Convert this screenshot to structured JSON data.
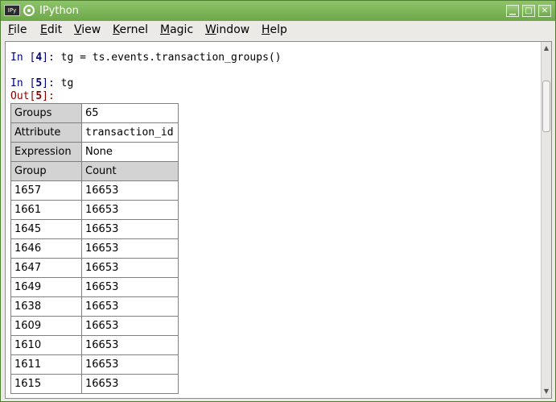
{
  "window": {
    "title": "IPython",
    "app_icon_text": "IPy",
    "minimize_glyph": "▁",
    "maximize_glyph": "□",
    "close_glyph": "✕"
  },
  "menu": [
    {
      "label": "File",
      "accel": "F",
      "rest": "ile"
    },
    {
      "label": "Edit",
      "accel": "E",
      "rest": "dit"
    },
    {
      "label": "View",
      "accel": "V",
      "rest": "iew"
    },
    {
      "label": "Kernel",
      "accel": "K",
      "rest": "ernel"
    },
    {
      "label": "Magic",
      "accel": "M",
      "rest": "agic"
    },
    {
      "label": "Window",
      "accel": "W",
      "rest": "indow"
    },
    {
      "label": "Help",
      "accel": "H",
      "rest": "elp"
    }
  ],
  "console": {
    "in4": {
      "prefix": "In [",
      "num": "4",
      "suffix": "]:",
      "code": " tg = ts.events.transaction_groups()"
    },
    "in5": {
      "prefix": "In [",
      "num": "5",
      "suffix": "]:",
      "code": " tg"
    },
    "out5": {
      "prefix": "Out[",
      "num": "5",
      "suffix": "]:"
    }
  },
  "table": {
    "meta": [
      {
        "key": "Groups",
        "value": "65"
      },
      {
        "key": "Attribute",
        "value": "transaction_id"
      },
      {
        "key": "Expression",
        "value": "None"
      }
    ],
    "header": {
      "col1": "Group",
      "col2": "Count"
    },
    "rows": [
      {
        "group": "1657",
        "count": "16653"
      },
      {
        "group": "1661",
        "count": "16653"
      },
      {
        "group": "1645",
        "count": "16653"
      },
      {
        "group": "1646",
        "count": "16653"
      },
      {
        "group": "1647",
        "count": "16653"
      },
      {
        "group": "1649",
        "count": "16653"
      },
      {
        "group": "1638",
        "count": "16653"
      },
      {
        "group": "1609",
        "count": "16653"
      },
      {
        "group": "1610",
        "count": "16653"
      },
      {
        "group": "1611",
        "count": "16653"
      },
      {
        "group": "1615",
        "count": "16653"
      }
    ]
  },
  "scrollbar": {
    "up_glyph": "▲",
    "down_glyph": "▼"
  }
}
